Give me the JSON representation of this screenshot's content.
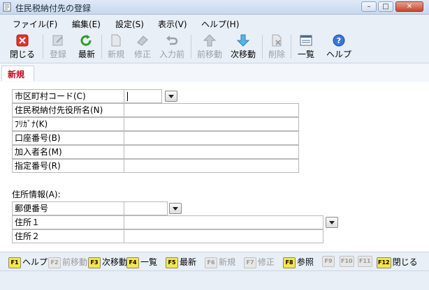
{
  "window": {
    "title": "住民税納付先の登録",
    "minimize": "–",
    "maximize": "□",
    "close": "✕"
  },
  "menu": [
    "ファイル(F)",
    "編集(E)",
    "設定(S)",
    "表示(V)",
    "ヘルプ(H)"
  ],
  "toolbar": [
    {
      "label": "閉じる",
      "icon": "close-icon",
      "enabled": true
    },
    {
      "label": "登録",
      "icon": "register-icon",
      "enabled": false
    },
    {
      "label": "最新",
      "icon": "refresh-icon",
      "enabled": true
    },
    {
      "label": "新規",
      "icon": "new-icon",
      "enabled": false
    },
    {
      "label": "修正",
      "icon": "eraser-icon",
      "enabled": false
    },
    {
      "label": "入力前",
      "icon": "undo-icon",
      "enabled": false
    },
    {
      "label": "前移動",
      "icon": "arrow-up-icon",
      "enabled": false
    },
    {
      "label": "次移動",
      "icon": "arrow-down-icon",
      "enabled": true
    },
    {
      "label": "削除",
      "icon": "delete-icon",
      "enabled": false
    },
    {
      "label": "一覧",
      "icon": "list-icon",
      "enabled": true
    },
    {
      "label": "ヘルプ",
      "icon": "help-icon",
      "enabled": true
    }
  ],
  "tab": {
    "label": "新規"
  },
  "form": {
    "fields": [
      {
        "label": "市区町村コード(C)",
        "value": ""
      },
      {
        "label": "住民税納付先役所名(N)",
        "value": ""
      },
      {
        "label": "ﾌﾘｶﾞﾅ(K)",
        "value": ""
      },
      {
        "label": "口座番号(B)",
        "value": ""
      },
      {
        "label": "加入者名(M)",
        "value": ""
      },
      {
        "label": "指定番号(R)",
        "value": ""
      }
    ],
    "address_section": "住所情報(A):",
    "address_fields": [
      {
        "label": "郵便番号",
        "value": ""
      },
      {
        "label": "住所１",
        "value": ""
      },
      {
        "label": "住所２",
        "value": ""
      }
    ]
  },
  "fkeys": [
    {
      "key": "F1",
      "label": "ヘルプ",
      "enabled": true
    },
    {
      "key": "F2",
      "label": "前移動",
      "enabled": false
    },
    {
      "key": "F3",
      "label": "次移動",
      "enabled": true
    },
    {
      "key": "F4",
      "label": "一覧",
      "enabled": true
    },
    {
      "key": "F5",
      "label": "最新",
      "enabled": true
    },
    {
      "key": "F6",
      "label": "新規",
      "enabled": false
    },
    {
      "key": "F7",
      "label": "修正",
      "enabled": false
    },
    {
      "key": "F8",
      "label": "参照",
      "enabled": true
    },
    {
      "key": "F9",
      "label": "",
      "enabled": false
    },
    {
      "key": "F10",
      "label": "",
      "enabled": false
    },
    {
      "key": "F11",
      "label": "",
      "enabled": false
    },
    {
      "key": "F12",
      "label": "閉じる",
      "enabled": true
    }
  ],
  "colors": {
    "accent_tab": "#d0021b",
    "fkey_active": "#f6e64a"
  }
}
